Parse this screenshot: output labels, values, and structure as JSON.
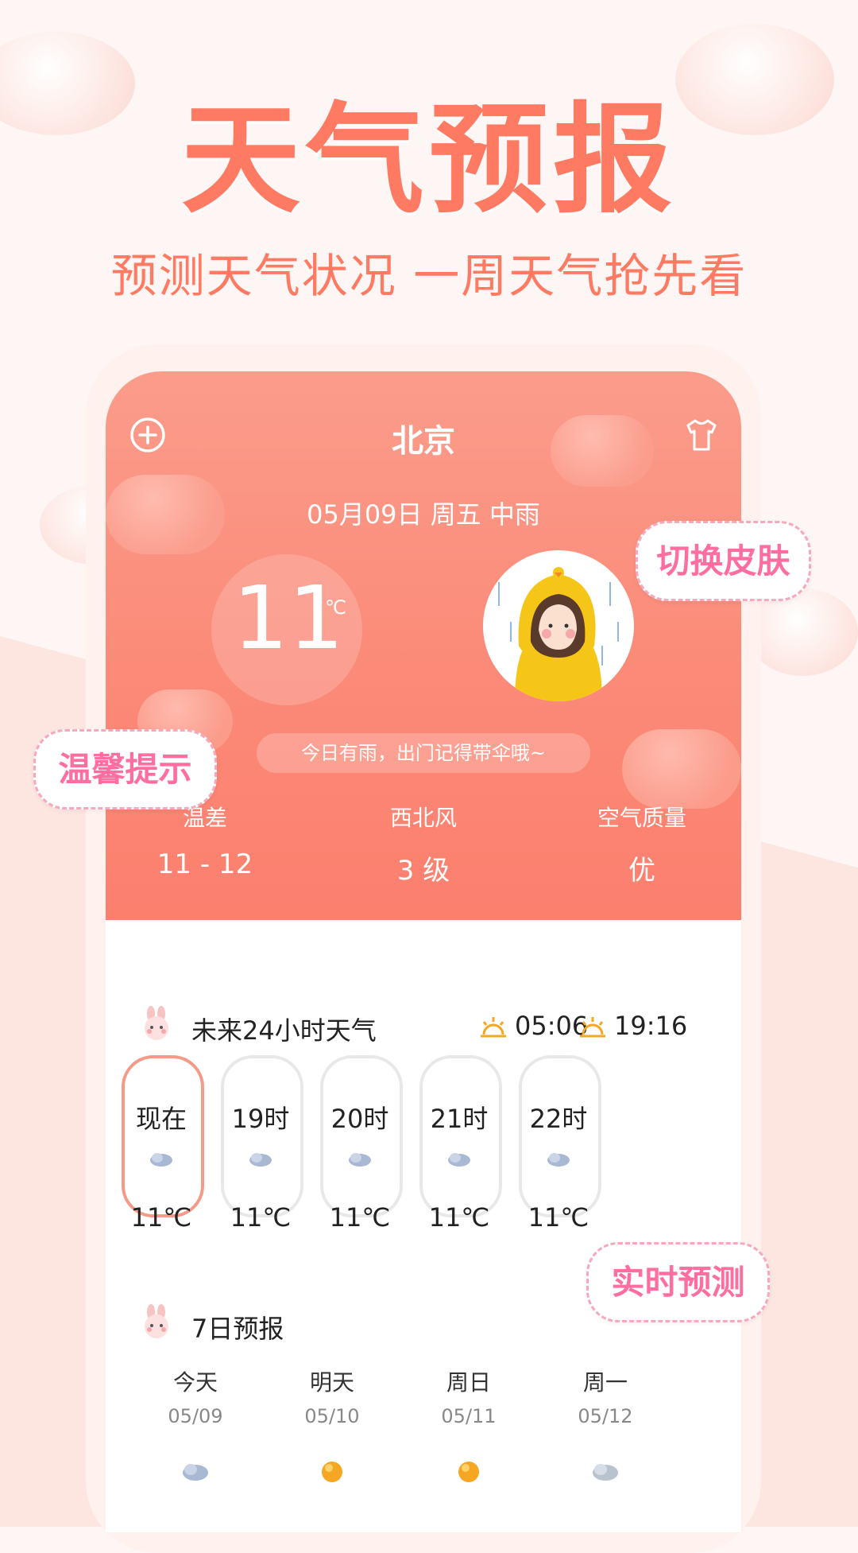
{
  "headline": {
    "title": "天气预报",
    "subtitle": "预测天气状况 一周天气抢先看"
  },
  "app": {
    "city": "北京",
    "date_line": "05月09日 周五 中雨",
    "temperature": "11",
    "temp_unit": "℃",
    "tip": "今日有雨，出门记得带伞哦~",
    "stats": [
      {
        "label": "温差",
        "value": "11 - 12"
      },
      {
        "label": "西北风",
        "value": "3 级"
      },
      {
        "label": "空气质量",
        "value": "优"
      }
    ],
    "hourly": {
      "title": "未来24小时天气",
      "sunrise": "05:06",
      "sunset": "19:16",
      "items": [
        {
          "time": "现在",
          "temp": "11℃"
        },
        {
          "time": "19时",
          "temp": "11℃"
        },
        {
          "time": "20时",
          "temp": "11℃"
        },
        {
          "time": "21时",
          "temp": "11℃"
        },
        {
          "time": "22时",
          "temp": "11℃"
        }
      ]
    },
    "weekly": {
      "title": "7日预报",
      "days": [
        {
          "name": "今天",
          "date": "05/09",
          "icon": "rain-cloud-icon"
        },
        {
          "name": "明天",
          "date": "05/10",
          "icon": "sun-icon"
        },
        {
          "name": "周日",
          "date": "05/11",
          "icon": "sun-icon"
        },
        {
          "name": "周一",
          "date": "05/12",
          "icon": "cloud-icon"
        }
      ]
    }
  },
  "stickers": {
    "skin": "切换皮肤",
    "tips": "温馨提示",
    "realtime": "实时预测"
  },
  "colors": {
    "accent": "#ff7a62",
    "hero": "#fb8a78",
    "sticker_text": "#ff6ea0",
    "sun": "#f5a623"
  }
}
